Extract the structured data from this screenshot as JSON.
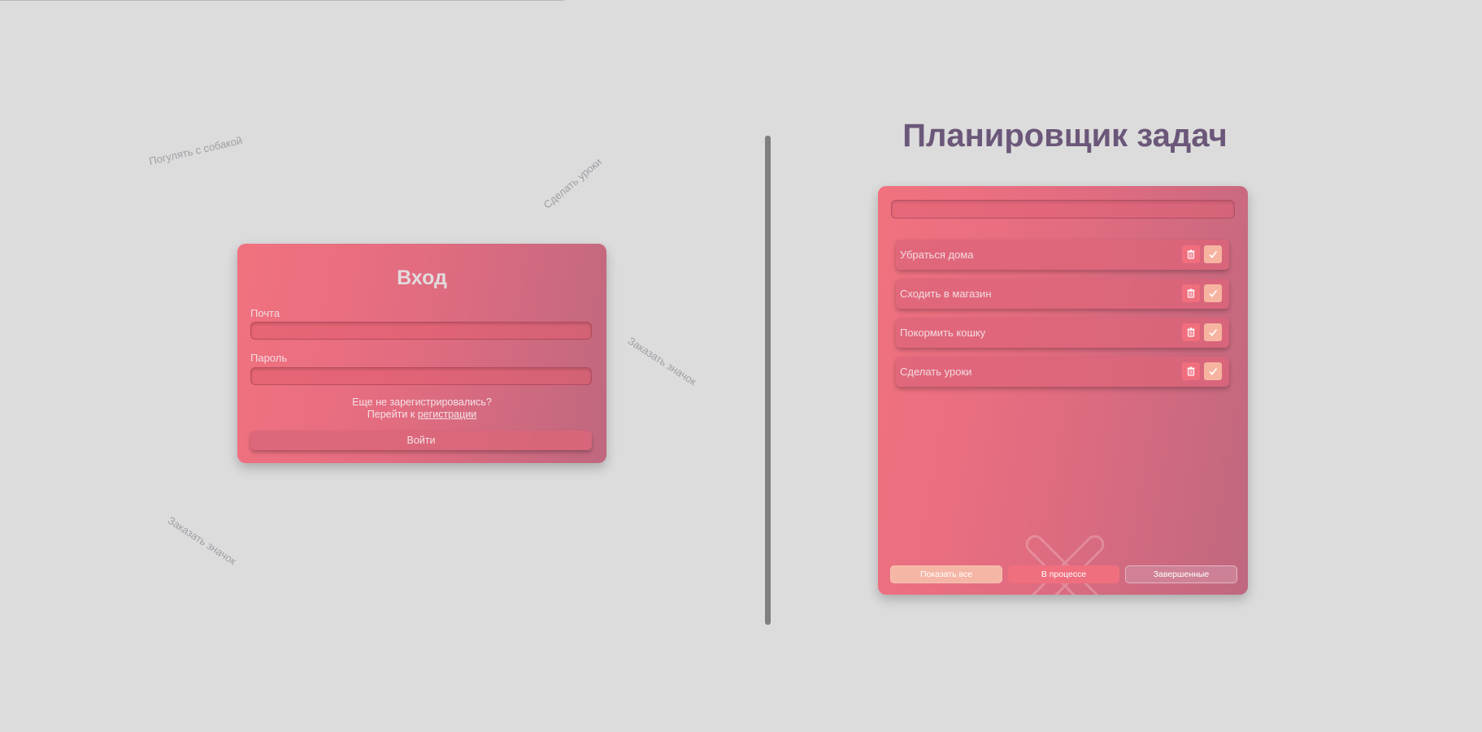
{
  "floating_words": [
    "Погулять с собакой",
    "Сделать уроки",
    "Заказать значок",
    "Заказать значок"
  ],
  "login": {
    "title": "Вход",
    "email_label": "Почта",
    "email_value": "",
    "password_label": "Пароль",
    "password_value": "",
    "register_prompt": "Еще не зарегистрировались?",
    "register_goto": "Перейти к ",
    "register_link": "регистрации",
    "submit_label": "Войти"
  },
  "app": {
    "title": "Планировщик задач",
    "task_input_value": "",
    "tasks": [
      {
        "text": "Убраться дома"
      },
      {
        "text": "Сходить в магазин"
      },
      {
        "text": "Покормить кошку"
      },
      {
        "text": "Сделать уроки"
      }
    ],
    "filters": {
      "all": "Показать все",
      "in_progress": "В процессе",
      "completed": "Завершенные"
    }
  },
  "icons": {
    "delete": "trash-icon",
    "complete": "check-icon",
    "watermark": "close-icon"
  },
  "colors": {
    "background": "#dcdcdc",
    "card_gradient_start": "#f1727f",
    "card_gradient_end": "#bf687f",
    "title": "#6b5779",
    "delete_button": "#f06e7d",
    "complete_button": "#f6b4a0",
    "divider": "#7f7e80"
  }
}
